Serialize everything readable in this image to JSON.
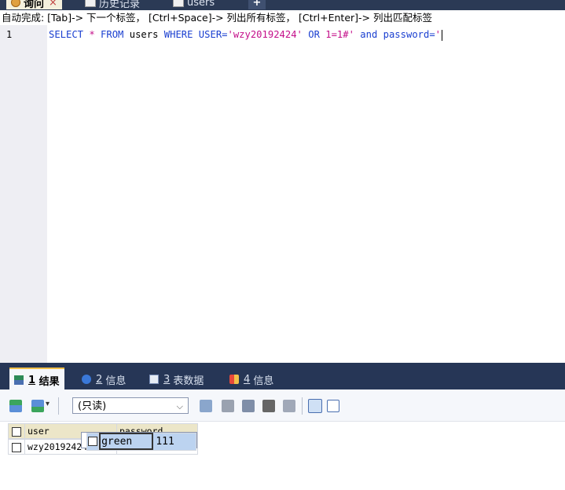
{
  "tabs": [
    {
      "label": "询问",
      "active": true,
      "close": "×"
    },
    {
      "label": "历史记录",
      "active": false
    },
    {
      "label": "users",
      "active": false
    },
    {
      "label": "+",
      "active": false
    }
  ],
  "hint": "自动完成: [Tab]-> 下一个标签， [Ctrl+Space]-> 列出所有标签， [Ctrl+Enter]-> 列出匹配标签",
  "editor": {
    "line_number": "1",
    "tokens": {
      "select": "SELECT",
      "star": " * ",
      "from": "FROM",
      "table": " users ",
      "where": "WHERE",
      "col": " USER=",
      "str1": "'wzy20192424'",
      "or": " OR ",
      "cond": "1=1#' ",
      "and": "and",
      "col2": " password=",
      "str2": "'"
    }
  },
  "result_tabs": [
    {
      "num": "1",
      "label": "结果",
      "active": true
    },
    {
      "num": "2",
      "label": "信息",
      "active": false
    },
    {
      "num": "3",
      "label": "表数据",
      "active": false
    },
    {
      "num": "4",
      "label": "信息",
      "active": false
    }
  ],
  "toolbar": {
    "mode": "(只读)",
    "dropdown_arrow": "⌵"
  },
  "grid": {
    "columns": [
      "user",
      "password"
    ],
    "rows": [
      [
        "green",
        "111"
      ],
      [
        "wzy20192424",
        "111"
      ]
    ]
  },
  "colors": {
    "tab_bg": "#2b3a55",
    "accent": "#f2c04a",
    "keyword": "#1a3fd0",
    "string": "#c40f8a",
    "grid_header": "#ece6c8",
    "row_selected": "#bcd3f0"
  }
}
